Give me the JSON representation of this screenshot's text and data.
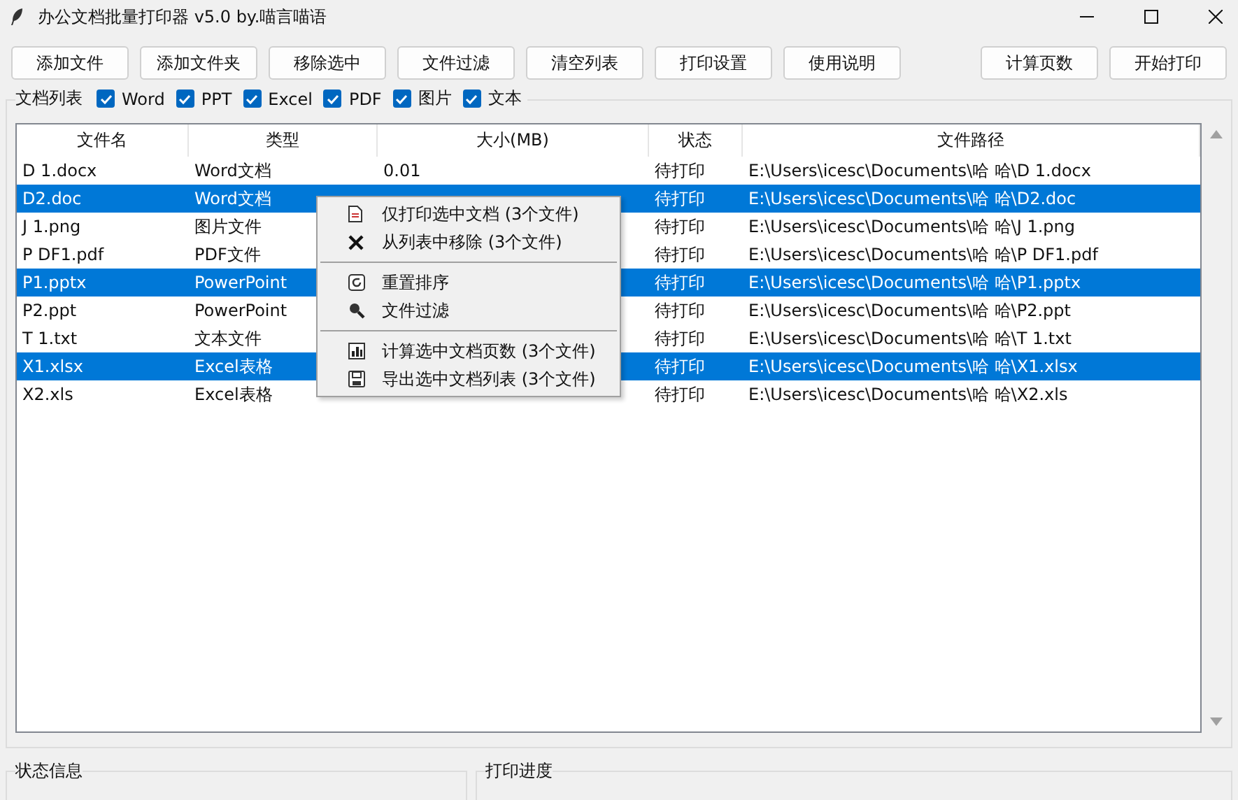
{
  "window": {
    "title": "办公文档批量打印器 v5.0 by.喵言喵语"
  },
  "toolbar": {
    "left": [
      "添加文件",
      "添加文件夹",
      "移除选中",
      "文件过滤",
      "清空列表",
      "打印设置",
      "使用说明"
    ],
    "right": [
      "计算页数",
      "开始打印"
    ]
  },
  "filters": {
    "label": "文档列表",
    "items": [
      {
        "label": "Word",
        "checked": true
      },
      {
        "label": "PPT",
        "checked": true
      },
      {
        "label": "Excel",
        "checked": true
      },
      {
        "label": "PDF",
        "checked": true
      },
      {
        "label": "图片",
        "checked": true
      },
      {
        "label": "文本",
        "checked": true
      }
    ]
  },
  "table": {
    "columns": [
      "文件名",
      "类型",
      "大小(MB)",
      "状态",
      "文件路径"
    ],
    "rows": [
      {
        "name": "D 1.docx",
        "type": "Word文档",
        "size": "0.01",
        "status": "待打印",
        "path": "E:\\Users\\icesc\\Documents\\哈 哈\\D 1.docx",
        "selected": false
      },
      {
        "name": "D2.doc",
        "type": "Word文档",
        "status": "待打印",
        "path": "E:\\Users\\icesc\\Documents\\哈 哈\\D2.doc",
        "selected": true
      },
      {
        "name": "J 1.png",
        "type": "图片文件",
        "status": "待打印",
        "path": "E:\\Users\\icesc\\Documents\\哈 哈\\J 1.png",
        "selected": false
      },
      {
        "name": "P DF1.pdf",
        "type": "PDF文件",
        "status": "待打印",
        "path": "E:\\Users\\icesc\\Documents\\哈 哈\\P DF1.pdf",
        "selected": false
      },
      {
        "name": "P1.pptx",
        "type": "PowerPoint",
        "status": "待打印",
        "path": "E:\\Users\\icesc\\Documents\\哈 哈\\P1.pptx",
        "selected": true
      },
      {
        "name": "P2.ppt",
        "type": "PowerPoint",
        "status": "待打印",
        "path": "E:\\Users\\icesc\\Documents\\哈 哈\\P2.ppt",
        "selected": false
      },
      {
        "name": "T 1.txt",
        "type": "文本文件",
        "status": "待打印",
        "path": "E:\\Users\\icesc\\Documents\\哈 哈\\T 1.txt",
        "selected": false
      },
      {
        "name": "X1.xlsx",
        "type": "Excel表格",
        "status": "待打印",
        "path": "E:\\Users\\icesc\\Documents\\哈 哈\\X1.xlsx",
        "selected": true
      },
      {
        "name": "X2.xls",
        "type": "Excel表格",
        "status": "待打印",
        "path": "E:\\Users\\icesc\\Documents\\哈 哈\\X2.xls",
        "selected": false
      }
    ]
  },
  "context_menu": {
    "groups": [
      [
        {
          "label": "仅打印选中文档 (3个文件)"
        },
        {
          "label": "从列表中移除 (3个文件)"
        }
      ],
      [
        {
          "label": "重置排序"
        },
        {
          "label": "文件过滤"
        }
      ],
      [
        {
          "label": "计算选中文档页数 (3个文件)"
        },
        {
          "label": "导出选中文档列表 (3个文件)"
        }
      ]
    ]
  },
  "bottom": {
    "status_label": "状态信息",
    "progress_label": "打印进度"
  }
}
